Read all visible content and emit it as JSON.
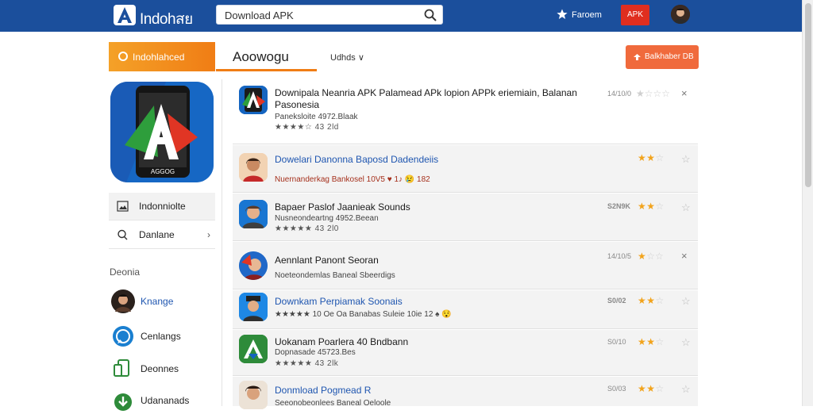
{
  "header": {
    "brand": "Indohสย",
    "search_value": "Download APK",
    "favorite_label": "Faroem",
    "apk_label": "APK"
  },
  "tabs": {
    "orange_label": "Indohlahced",
    "active_label": "Aoowogu",
    "filter_label": "Udhds ∨"
  },
  "share_label": "Balkhaber DB",
  "sidebar": {
    "items": [
      {
        "label": "Indonniolte"
      },
      {
        "label": "Danlane",
        "chevron": "›"
      }
    ],
    "section_label": "Deonia",
    "categories": [
      {
        "label": "Knange"
      },
      {
        "label": "Cenlangs"
      },
      {
        "label": "Deonnes"
      },
      {
        "label": "Udananads"
      }
    ]
  },
  "list": [
    {
      "title": "Downipala Neanria APK Palamead APk lopion APPk eriemiain, Balanan Pasonesia",
      "sub": "Paneksloite 4972.Blaak",
      "rating_text": "★★★★☆ 43 2ld",
      "date": "14/10/0",
      "right_stars": "★☆☆☆",
      "close": "×"
    },
    {
      "title": "Dowelari Danonna Baposd Dadendeiis",
      "sub": "Nuernanderkag Bankosel 10V5 ♥ 1♪ 😢 182",
      "date": "",
      "right_stars": "★★☆",
      "close": "☆"
    },
    {
      "title": "Bapaer Paslof Jaanieak Sounds",
      "sub": "Nusneondeartng 4952.Beean",
      "rating_text": "★★★★★ 43 2l0",
      "date": "S2N9K",
      "right_stars": "★★☆",
      "close": "☆"
    },
    {
      "title": "Aennlant Panont Seoran",
      "sub": "Noeteondemlas Baneal Sbeerdigs",
      "date": "14/10/5",
      "right_stars": "★☆☆",
      "close": "×"
    },
    {
      "title": "Downkam Perpiamak Soonais",
      "sub": "★★★★★ 10 Oe Oa Banabas Suleie 10ie 12 ♠ 😯",
      "date": "S0/02",
      "right_stars": "★★☆",
      "close": "☆"
    },
    {
      "title": "Uokanam Poarlera 40 Bndbann",
      "sub": "Dopnasade 45723.Bes",
      "rating_text": "★★★★★ 43 2lk",
      "date": "S0/10",
      "right_stars": "★★☆",
      "close": "☆"
    },
    {
      "title": "Donmload Pogmead R",
      "sub": "Seeonobeonlees Baneal Oeloole",
      "date": "S0/03",
      "right_stars": "★★☆",
      "close": "☆"
    }
  ],
  "colors": {
    "header": "#1b4f9c",
    "orange": "#f07d15",
    "red": "#e02e1f",
    "share": "#f06a3c",
    "link_blue": "#1f56b0",
    "star": "#f2a31b"
  }
}
